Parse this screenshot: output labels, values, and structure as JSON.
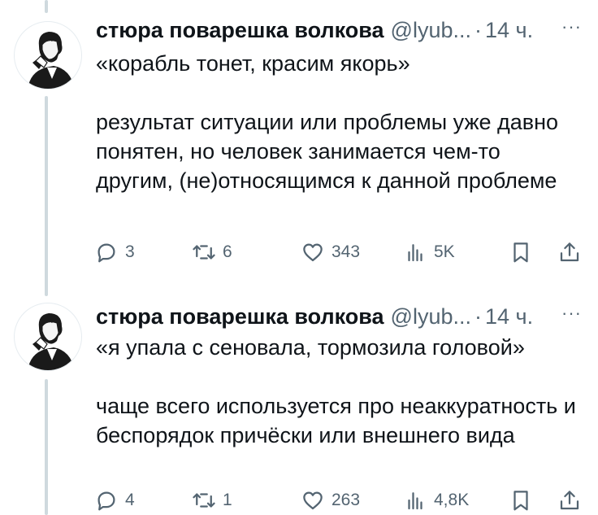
{
  "tweets": [
    {
      "author": "стюра поварешка волкова",
      "handle": "@lyub...",
      "separator": "·",
      "time": "14 ч.",
      "more": "···",
      "text": [
        "«корабль тонет, красим якорь»",
        "",
        "результат ситуации или проблемы уже давно понятен, но человек занимается чем-то другим, (не)относящимся к данной проблеме"
      ],
      "replies": "3",
      "retweets": "6",
      "likes": "343",
      "views": "5K"
    },
    {
      "author": "стюра поварешка волкова",
      "handle": "@lyub...",
      "separator": "·",
      "time": "14 ч.",
      "more": "···",
      "text": [
        "«я упала с сеновала, тормозила головой»",
        "",
        "чаще всего используется про неаккуратность и беспорядок причёски или внешнего вида"
      ],
      "replies": "4",
      "retweets": "1",
      "likes": "263",
      "views": "4,8K"
    }
  ],
  "icons": {
    "reply": "reply-icon",
    "retweet": "retweet-icon",
    "like": "heart-icon",
    "views": "views-icon",
    "bookmark": "bookmark-icon",
    "share": "share-icon"
  },
  "colors": {
    "text": "#0f1419",
    "secondary": "#536471",
    "thread_line": "#cfd9de"
  }
}
